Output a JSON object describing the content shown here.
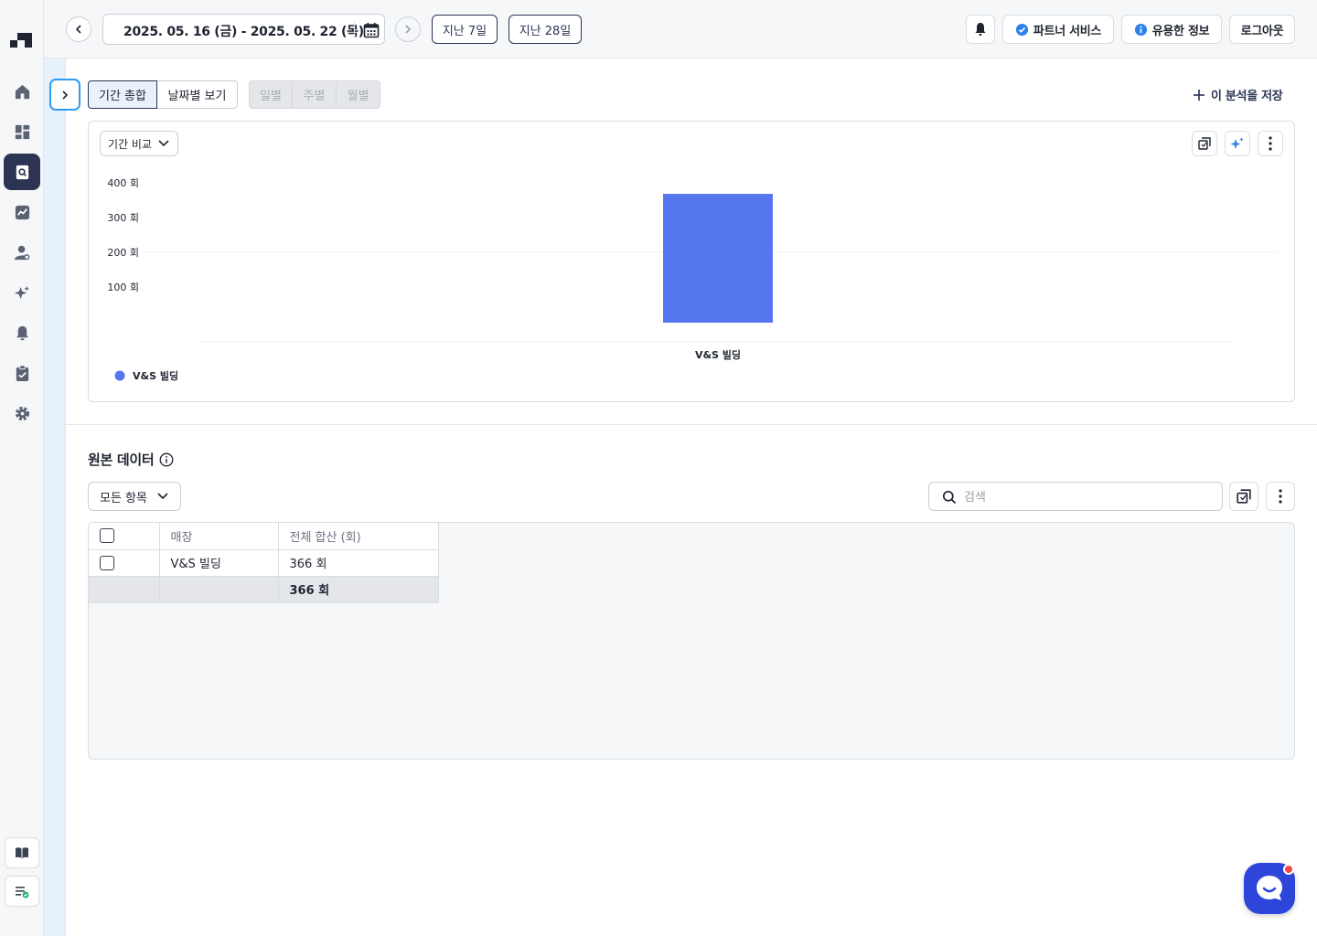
{
  "header": {
    "date_range": "2025. 05. 16 (금) - 2025. 05. 22 (목)",
    "quick_ranges": [
      "지난 7일",
      "지난 28일"
    ],
    "partner_label": "파트너 서비스",
    "info_label": "유용한 정보",
    "logout_label": "로그아웃"
  },
  "toolbar": {
    "view_tabs": [
      "기간 총합",
      "날짜별 보기"
    ],
    "active_view": "기간 총합",
    "granularity_tabs": [
      "일별",
      "주별",
      "월별"
    ],
    "save_label": "이 분석을 저장"
  },
  "chart_card": {
    "compare_label": "기간 비교"
  },
  "chart_data": {
    "type": "bar",
    "categories": [
      "V&S 빌딩"
    ],
    "series": [
      {
        "name": "V&S 빌딩",
        "values": [
          366
        ],
        "color": "#5676f0"
      }
    ],
    "yticks": [
      "400 회",
      "300 회",
      "200 회",
      "100 회"
    ],
    "ylim": [
      0,
      400
    ],
    "legend": "bottom-left",
    "grid": false
  },
  "raw_data": {
    "title": "원본 데이터",
    "filter_label": "모든 항목",
    "search_placeholder": "검색",
    "columns": [
      "매장",
      "전체 합산 (회)"
    ],
    "rows": [
      {
        "store": "V&S 빌딩",
        "total": "366 회"
      }
    ],
    "total_row": {
      "total": "366 회"
    }
  },
  "colors": {
    "accent": "#2b3553",
    "bar": "#5676f0",
    "highlight": "#2f9bf5",
    "chat": "#2e45d9"
  }
}
